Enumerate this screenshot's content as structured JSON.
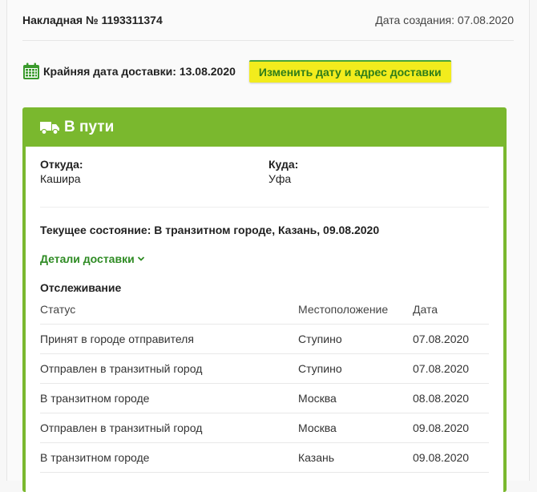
{
  "header": {
    "invoice_title": "Накладная № 1193311374",
    "created": "Дата создания: 07.08.2020"
  },
  "deadline": {
    "text": "Крайняя дата доставки: 13.08.2020",
    "change_button": "Изменить дату и адрес доставки"
  },
  "status_card": {
    "title": "В пути",
    "from_label": "Откуда:",
    "from_value": "Кашира",
    "to_label": "Куда:",
    "to_value": "Уфа",
    "current_state": "Текущее состояние: В транзитном городе, Казань, 09.08.2020",
    "details_link": "Детали доставки"
  },
  "tracking": {
    "title": "Отслеживание",
    "columns": [
      "Статус",
      "Местоположение",
      "Дата"
    ],
    "rows": [
      [
        "Принят в городе отправителя",
        "Ступино",
        "07.08.2020"
      ],
      [
        "Отправлен в транзитный город",
        "Ступино",
        "07.08.2020"
      ],
      [
        "В транзитном городе",
        "Москва",
        "08.08.2020"
      ],
      [
        "Отправлен в транзитный город",
        "Москва",
        "09.08.2020"
      ],
      [
        "В транзитном городе",
        "Казань",
        "09.08.2020"
      ]
    ]
  },
  "colors": {
    "card_green": "#7ab82e",
    "button_yellow": "#f2ec1d",
    "link_green": "#2e8b23"
  },
  "icons": [
    "calendar-icon",
    "truck-icon",
    "chevron-down-icon"
  ]
}
